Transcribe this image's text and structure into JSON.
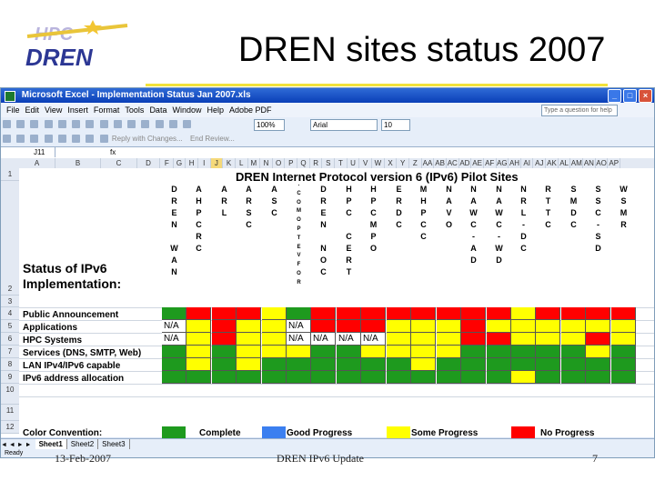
{
  "slide": {
    "title": "DREN sites status 2007",
    "footer_left": "13-Feb-2007",
    "footer_center": "DREN IPv6 Update",
    "footer_right": "7"
  },
  "excel": {
    "window_title": "Microsoft Excel - Implementation Status Jan 2007.xls",
    "menu": [
      "File",
      "Edit",
      "View",
      "Insert",
      "Format",
      "Tools",
      "Data",
      "Window",
      "Help",
      "Adobe PDF"
    ],
    "help_placeholder": "Type a question for help",
    "zoom": "100%",
    "font": "Arial",
    "font_size": "10",
    "reply_text": "Reply with Changes...",
    "end_review": "End Review...",
    "name_box": "J11",
    "fx": "fx",
    "column_headers": [
      "A",
      "B",
      "C",
      "D",
      "F",
      "G",
      "H",
      "I",
      "J",
      "K",
      "L",
      "M",
      "N",
      "O",
      "P",
      "Q",
      "R",
      "S",
      "T",
      "U",
      "V",
      "W",
      "X",
      "Y",
      "Z",
      "AA",
      "AB",
      "AC",
      "AD",
      "AE",
      "AF",
      "AG",
      "AH",
      "AI",
      "AJ",
      "AK",
      "AL",
      "AM",
      "AN",
      "AO",
      "AP"
    ],
    "sheet_tabs": [
      "Sheet1",
      "Sheet2",
      "Sheet3"
    ],
    "status_text": "Ready"
  },
  "sheet": {
    "title": "DREN Internet Protocol version 6 (IPv6) Pilot Sites",
    "status_label": "Status of IPv6 Implementation:",
    "row_numbers": [
      "1",
      "2",
      "3",
      "4",
      "5",
      "6",
      "7",
      "8",
      "9",
      "10",
      "11",
      "12"
    ],
    "rows": [
      "Public Announcement",
      "Applications",
      "HPC Systems",
      "Services (DNS, SMTP, Web)",
      "LAN IPv4/IPv6 capable",
      "IPv6 address allocation"
    ],
    "legend_title": "Color Convention:",
    "legend": [
      {
        "label": "Complete",
        "color": "#1e9a1e"
      },
      {
        "label": "Good Progress",
        "color": "#3b7ff0"
      },
      {
        "label": "Some Progress",
        "color": "#ffff00"
      },
      {
        "label": "No Progress",
        "color": "#ff0000"
      }
    ],
    "sites": [
      {
        "name": "DREN\nWAN",
        "status": [
          "green",
          "na",
          "na",
          "green",
          "green",
          "green"
        ],
        "na": [
          "",
          "N/A",
          "N/A",
          "",
          "",
          ""
        ]
      },
      {
        "name": "AHPCRC",
        "status": [
          "red",
          "yellow",
          "yellow",
          "yellow",
          "yellow",
          "green"
        ]
      },
      {
        "name": "ARL",
        "status": [
          "red",
          "red",
          "red",
          "green",
          "green",
          "green"
        ]
      },
      {
        "name": "ARSC",
        "status": [
          "red",
          "yellow",
          "yellow",
          "yellow",
          "yellow",
          "green"
        ]
      },
      {
        "name": "ASC",
        "status": [
          "yellow",
          "yellow",
          "yellow",
          "yellow",
          "green",
          "green"
        ]
      },
      {
        "name": ".COMOPTEVFOR",
        "small": true,
        "status": [
          "green",
          "na",
          "na",
          "yellow",
          "green",
          "green"
        ],
        "na": [
          "",
          "N/A",
          "N/A",
          "",
          "",
          " "
        ]
      },
      {
        "name": "DREN\nNOC",
        "status": [
          "red",
          "red",
          "na",
          "green",
          "green",
          "green"
        ],
        "na": [
          "",
          "",
          "N/A",
          "",
          "",
          ""
        ]
      },
      {
        "name": "HPC\nCERT",
        "status": [
          "red",
          "red",
          "na",
          "green",
          "green",
          "green"
        ],
        "na": [
          "",
          "",
          "N/A",
          "",
          "",
          ""
        ]
      },
      {
        "name": "HPCMPO",
        "status": [
          "red",
          "red",
          "na",
          "yellow",
          "green",
          "green"
        ],
        "na": [
          "",
          "",
          "N/A",
          "",
          "",
          ""
        ]
      },
      {
        "name": "ERDC",
        "status": [
          "red",
          "yellow",
          "yellow",
          "yellow",
          "green",
          "green"
        ]
      },
      {
        "name": "MHPCC",
        "status": [
          "red",
          "yellow",
          "yellow",
          "yellow",
          "yellow",
          "green"
        ]
      },
      {
        "name": "NAVO",
        "status": [
          "red",
          "yellow",
          "yellow",
          "yellow",
          "green",
          "green"
        ]
      },
      {
        "name": "NAWC-AD",
        "status": [
          "red",
          "red",
          "red",
          "green",
          "green",
          "green"
        ]
      },
      {
        "name": "NAWC-WD",
        "status": [
          "red",
          "yellow",
          "red",
          "green",
          "green",
          "green"
        ]
      },
      {
        "name": "NRL-DC",
        "status": [
          "yellow",
          "yellow",
          "yellow",
          "green",
          "green",
          "yellow"
        ]
      },
      {
        "name": "RTTC",
        "status": [
          "red",
          "yellow",
          "yellow",
          "green",
          "green",
          "green"
        ]
      },
      {
        "name": "SMDC",
        "status": [
          "red",
          "yellow",
          "yellow",
          "green",
          "green",
          "green"
        ]
      },
      {
        "name": "SSC-SD",
        "status": [
          "red",
          "yellow",
          "red",
          "yellow",
          "green",
          "green"
        ]
      },
      {
        "name": "WSMR",
        "status": [
          "red",
          "yellow",
          "yellow",
          "green",
          "green",
          "green"
        ]
      }
    ]
  }
}
